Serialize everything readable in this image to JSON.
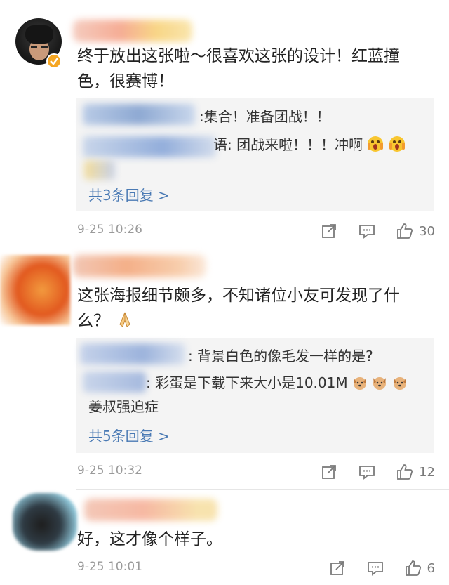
{
  "comments": [
    {
      "text": "终于放出这张啦～很喜欢这张的设计！红蓝撞色，很赛博！",
      "replies": [
        {
          "text": ":集合！准备团战！！"
        },
        {
          "text": "语: 团战来啦！！！冲啊"
        }
      ],
      "more": "共3条回复 >",
      "time": "9-25 10:26",
      "likes": "30"
    },
    {
      "text": "这张海报细节颇多，不知诸位小友可发现了什么？",
      "replies": [
        {
          "text": ": 背景白色的像毛发一样的是?"
        },
        {
          "text": ": 彩蛋是下载下来大小是10.01M"
        },
        {
          "text": "姜叔强迫症"
        }
      ],
      "more": "共5条回复 >",
      "time": "9-25 10:32",
      "likes": "12"
    },
    {
      "text": "好，这才像个样子。",
      "time": "9-25 10:01",
      "likes": "6"
    }
  ],
  "icons": {
    "share": "share-icon",
    "reply": "comment-icon",
    "like": "thumbs-up-icon",
    "verified": "verified-badge-icon"
  },
  "colors": {
    "link": "#4a7ab4",
    "verified_badge": "#f5a623"
  }
}
